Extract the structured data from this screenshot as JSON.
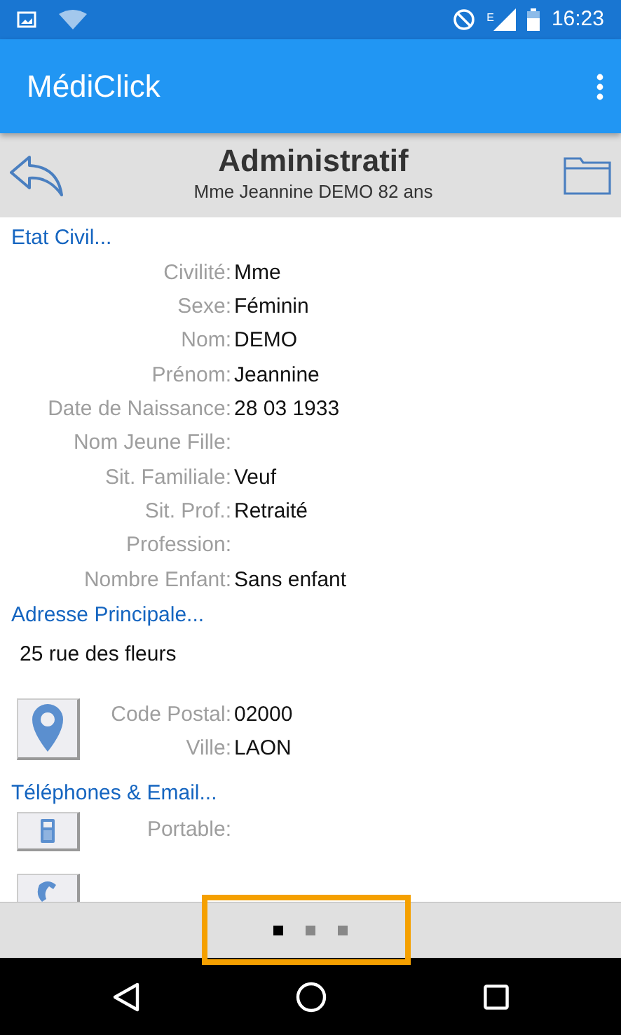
{
  "status_bar": {
    "time": "16:23",
    "network": "E"
  },
  "app_bar": {
    "title": "MédiClick"
  },
  "header": {
    "title": "Administratif",
    "subtitle": "Mme Jeannine DEMO 82 ans"
  },
  "sections": [
    {
      "title": "Etat Civil...",
      "items": [
        {
          "kind": "field",
          "label": "Civilité:",
          "value": "Mme"
        },
        {
          "kind": "field",
          "label": "Sexe:",
          "value": "Féminin"
        },
        {
          "kind": "field",
          "label": "Nom:",
          "value": "DEMO"
        },
        {
          "kind": "field",
          "label": "Prénom:",
          "value": "Jeannine"
        },
        {
          "kind": "field",
          "label": "Date de Naissance:",
          "value": "28 03 1933"
        },
        {
          "kind": "field",
          "label": "Nom Jeune Fille:"
        },
        {
          "kind": "field",
          "label": "Sit. Familiale:",
          "value": "Veuf"
        },
        {
          "kind": "field",
          "label": "Sit. Prof.:",
          "value": "Retraité"
        },
        {
          "kind": "field",
          "label": "Profession:"
        },
        {
          "kind": "field",
          "label": "Nombre Enfant:",
          "value": "Sans enfant"
        }
      ]
    },
    {
      "title": "Adresse Principale...",
      "items": [
        {
          "kind": "line",
          "text": "25 rue des fleurs"
        },
        {
          "kind": "map",
          "fields": [
            {
              "label": "Code Postal:",
              "value": "02000"
            },
            {
              "label": "Ville:",
              "value": "LAON"
            }
          ]
        }
      ]
    },
    {
      "title": "Téléphones & Email...",
      "items": [
        {
          "kind": "mobile",
          "fields": [
            {
              "label": "Portable:"
            }
          ]
        },
        {
          "kind": "phone"
        }
      ]
    }
  ],
  "pager": [
    {
      "selected": true
    },
    {
      "selected": false
    },
    {
      "selected": false
    }
  ],
  "highlight": true
}
